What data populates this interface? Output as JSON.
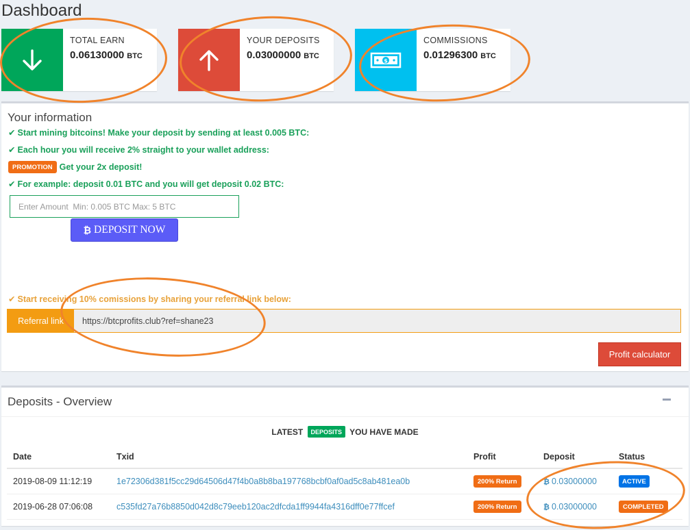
{
  "page_title": "Dashboard",
  "stats": [
    {
      "label": "TOTAL EARN",
      "value": "0.06130000",
      "unit": "BTC",
      "color": "#00a65a",
      "icon": "arrow-down-icon"
    },
    {
      "label": "YOUR DEPOSITS",
      "value": "0.03000000",
      "unit": "BTC",
      "color": "#dd4b39",
      "icon": "arrow-up-icon"
    },
    {
      "label": "COMMISSIONS",
      "value": "0.01296300",
      "unit": "BTC",
      "color": "#00c0ef",
      "icon": "money-bill-icon"
    }
  ],
  "info": {
    "title": "Your information",
    "line1": "Start mining bitcoins! Make your deposit by sending at least 0.005 BTC:",
    "line2": "Each hour you will receive 2% straight to your wallet address:",
    "promo_badge": "PROMOTION",
    "promo_text": "Get your 2x deposit!",
    "line3": "For example: deposit 0.01 BTC and you will get deposit 0.02 BTC:",
    "amount_placeholder": "Enter Amount  Min: 0.005 BTC Max: 5 BTC",
    "deposit_button": "DEPOSIT NOW",
    "referral_note": "Start receiving 10% comissions by sharing your referral link below:",
    "referral_label": "Referral link",
    "referral_url": "https://btcprofits.club?ref=shane23",
    "calc_button": "Profit calculator"
  },
  "deposits": {
    "title": "Deposits - Overview",
    "latest_prefix": "LATEST",
    "latest_badge": "DEPOSITS",
    "latest_suffix": "YOU HAVE MADE",
    "columns": [
      "Date",
      "Txid",
      "Profit",
      "Deposit",
      "Status"
    ],
    "rows": [
      {
        "date": "2019-08-09 11:12:19",
        "txid": "1e72306d381f5cc29d64506d47f4b0a8b8ba197768bcbf0af0ad5c8ab481ea0b",
        "profit": "200% Return",
        "deposit": "0.03000000",
        "status": "ACTIVE"
      },
      {
        "date": "2019-06-28 07:06:08",
        "txid": "c535fd27a76b8850d042d8c79eeb120ac2dfcda1ff9944fa4316dff0e77ffcef",
        "profit": "200% Return",
        "deposit": "0.03000000",
        "status": "COMPLETED"
      }
    ]
  },
  "accent_colors": {
    "green_text": "#1aa05a",
    "orange_text": "#e8a23a",
    "annotation_oval": "#f0832b"
  }
}
